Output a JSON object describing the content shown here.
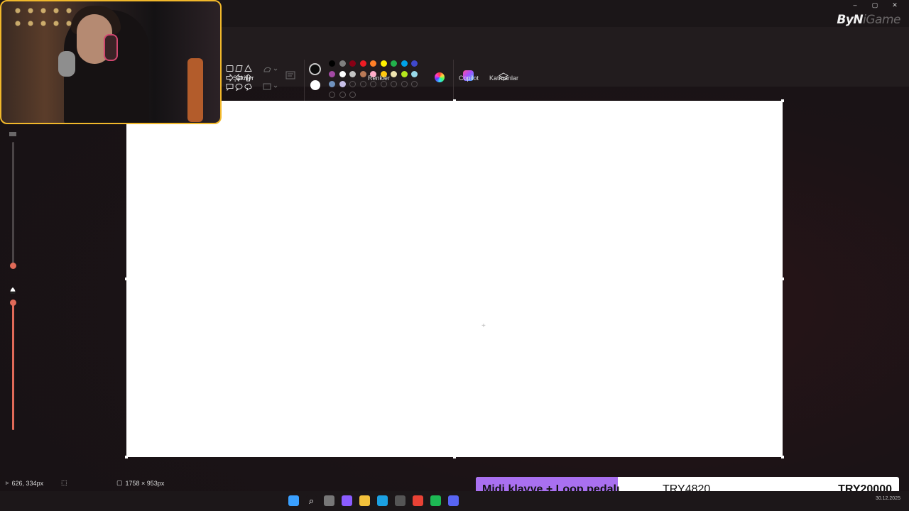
{
  "window": {
    "controls": [
      "–",
      "▢",
      "✕"
    ]
  },
  "brand": {
    "main": "ByN",
    "ghost": "iGame"
  },
  "ribbon": {
    "groups": {
      "shapes": "Şekiller",
      "colors": "Renkler",
      "copilot": "Copilot",
      "layers": "Katmanlar"
    },
    "current_colors": {
      "primary": "#0b0b0b",
      "secondary": "#ffffff"
    },
    "palette": [
      "#000000",
      "#7f7f7f",
      "#880015",
      "#ed1c24",
      "#ff7f27",
      "#fff200",
      "#22b14c",
      "#00a2e8",
      "#3f48cc",
      "#a349a4",
      "#ffffff",
      "#c3c3c3",
      "#b97a57",
      "#ffaec9",
      "#ffc90e",
      "#efe4b0",
      "#b5e61d",
      "#99d9ea",
      "#7092be",
      "#c8bfe7",
      "empty",
      "empty",
      "empty",
      "empty",
      "empty",
      "empty",
      "empty",
      "empty",
      "empty",
      "empty"
    ]
  },
  "status": {
    "cursor_pos": "626, 334px",
    "canvas_size": "1758 × 953px"
  },
  "donation": {
    "title_highlight": "Midi klavye + Loop",
    "title_rest": "pedalı",
    "current": "TRY4820",
    "goal": "TRY20000",
    "progress_fraction": 0.241
  },
  "taskbar": {
    "icons": [
      "windows-start-icon",
      "search-icon",
      "task-view-icon",
      "copilot-icon",
      "file-explorer-icon",
      "edge-icon",
      "store-icon",
      "chrome-icon",
      "spotify-icon",
      "discord-icon"
    ]
  },
  "tray": {
    "date": "30.12.2025"
  }
}
